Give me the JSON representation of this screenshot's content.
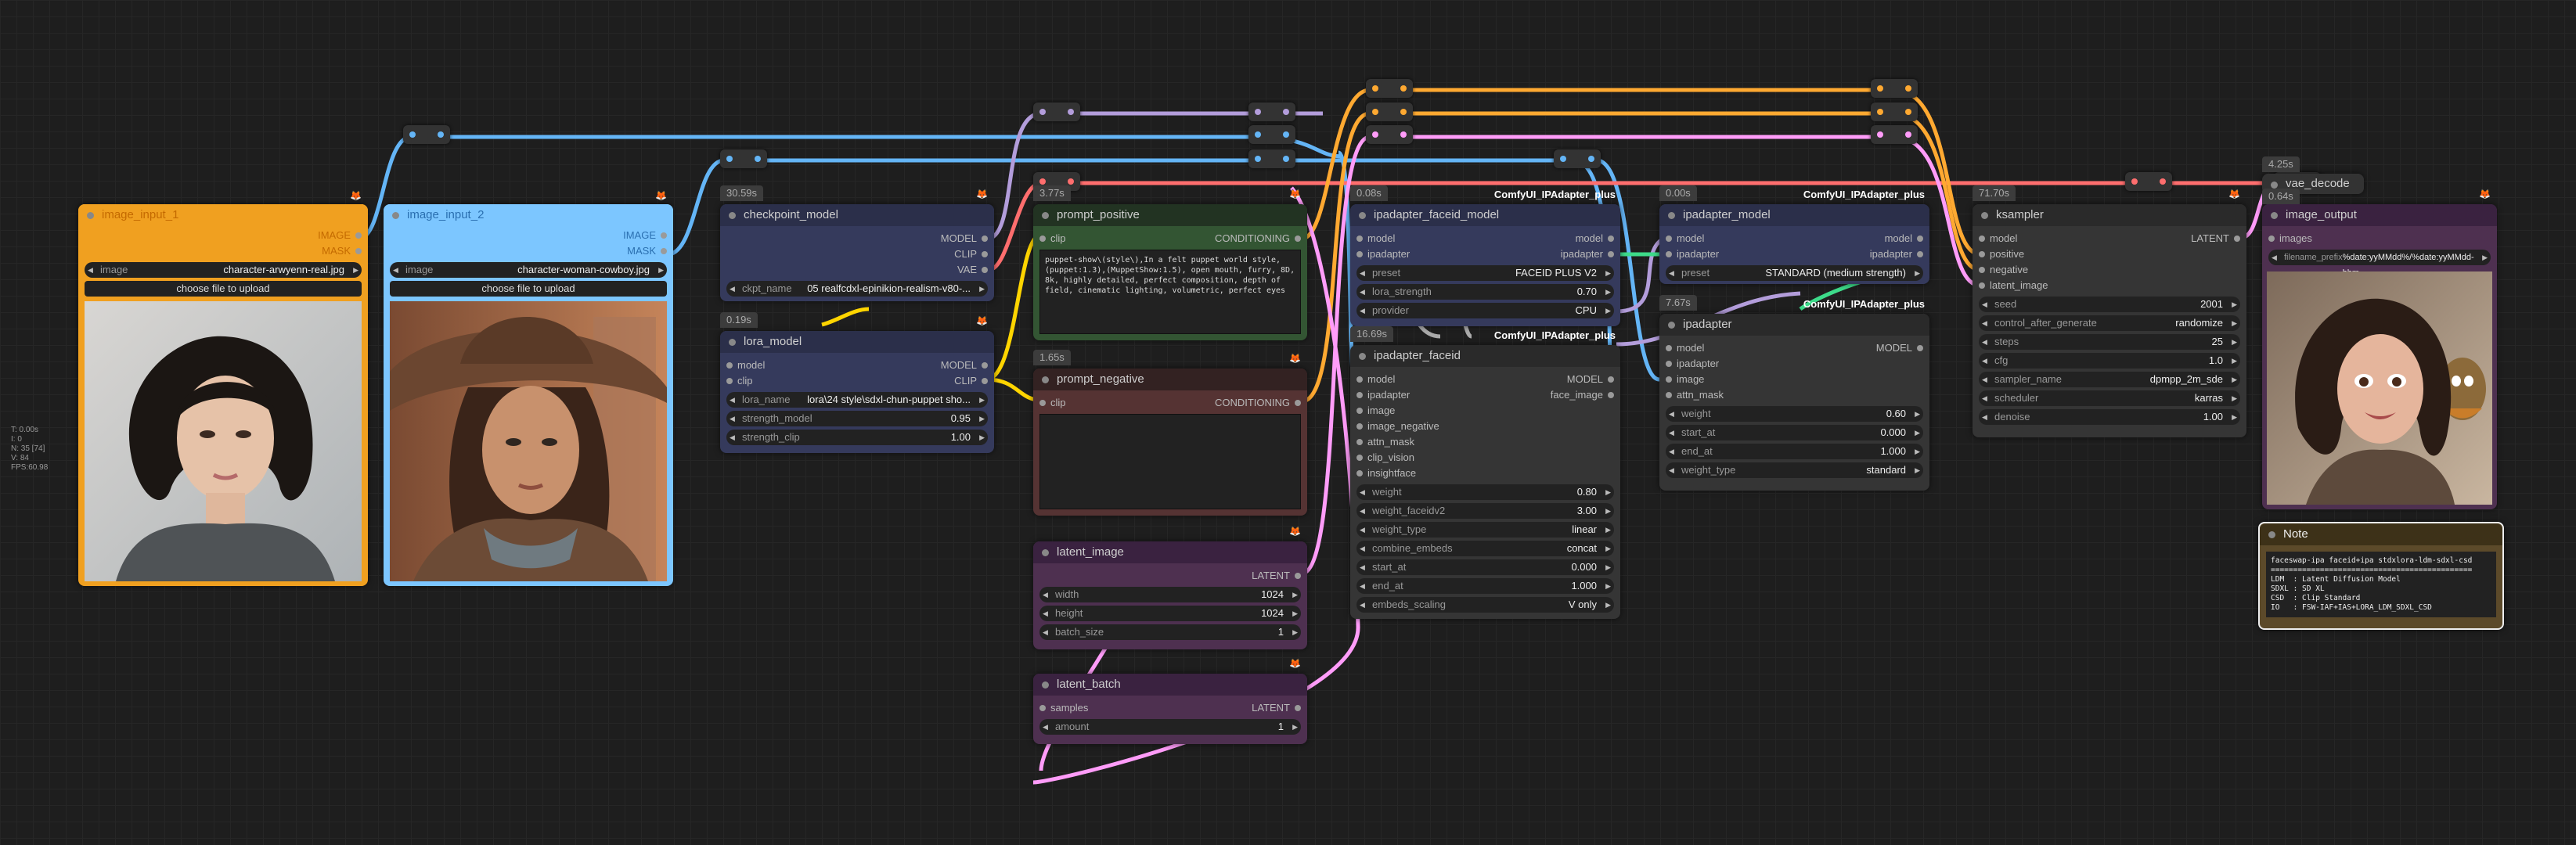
{
  "stats": [
    "T: 0.00s",
    "I: 0",
    "N: 35 [74]",
    "V: 84",
    "FPS:60.98"
  ],
  "nodes": {
    "image_input_1": {
      "title": "image_input_1",
      "outputs": [
        "IMAGE",
        "MASK"
      ],
      "widget_label": "image",
      "widget_value": "character-arwyenn-real.jpg",
      "button": "choose file to upload"
    },
    "image_input_2": {
      "title": "image_input_2",
      "outputs": [
        "IMAGE",
        "MASK"
      ],
      "widget_label": "image",
      "widget_value": "character-woman-cowboy.jpg",
      "button": "choose file to upload"
    },
    "checkpoint_model": {
      "time": "30.59s",
      "title": "checkpoint_model",
      "outputs": [
        "MODEL",
        "CLIP",
        "VAE"
      ],
      "widgets": [
        {
          "label": "ckpt_name",
          "value": "05 realfcdxl-epinikion-realism-v80-..."
        }
      ]
    },
    "lora_model": {
      "time": "0.19s",
      "title": "lora_model",
      "io": [
        {
          "in": "model",
          "out": "MODEL"
        },
        {
          "in": "clip",
          "out": "CLIP"
        }
      ],
      "widgets": [
        {
          "label": "lora_name",
          "value": "lora\\24 style\\sdxl-chun-puppet sho..."
        },
        {
          "label": "strength_model",
          "value": "0.95"
        },
        {
          "label": "strength_clip",
          "value": "1.00"
        }
      ]
    },
    "prompt_positive": {
      "time": "3.77s",
      "title": "prompt_positive",
      "input": "clip",
      "output": "CONDITIONING",
      "text": "puppet-show\\(style\\),In a felt puppet world style, (puppet:1.3),(MuppetShow:1.5), open mouth, furry, 8D, 8k, highly detailed, perfect composition, depth of field, cinematic lighting, volumetric, perfect eyes"
    },
    "prompt_negative": {
      "time": "1.65s",
      "title": "prompt_negative",
      "input": "clip",
      "output": "CONDITIONING",
      "text": ""
    },
    "latent_image": {
      "title": "latent_image",
      "output": "LATENT",
      "widgets": [
        {
          "label": "width",
          "value": "1024"
        },
        {
          "label": "height",
          "value": "1024"
        },
        {
          "label": "batch_size",
          "value": "1"
        }
      ]
    },
    "latent_batch": {
      "title": "latent_batch",
      "input": "samples",
      "output": "LATENT",
      "widgets": [
        {
          "label": "amount",
          "value": "1"
        }
      ]
    },
    "ipadapter_faceid_model": {
      "time": "0.08s",
      "pack": "ComfyUI_IPAdapter_plus",
      "title": "ipadapter_faceid_model",
      "io": [
        {
          "in": "model",
          "out": "model"
        },
        {
          "in": "ipadapter",
          "out": "ipadapter"
        }
      ],
      "widgets": [
        {
          "label": "preset",
          "value": "FACEID PLUS V2"
        },
        {
          "label": "lora_strength",
          "value": "0.70"
        },
        {
          "label": "provider",
          "value": "CPU"
        }
      ]
    },
    "ipadapter_faceid": {
      "time": "16.69s",
      "pack": "ComfyUI_IPAdapter_plus",
      "title": "ipadapter_faceid",
      "io": [
        {
          "in": "model",
          "out": "MODEL"
        },
        {
          "in": "ipadapter",
          "out": "face_image"
        }
      ],
      "inputs": [
        "image",
        "image_negative",
        "attn_mask",
        "clip_vision",
        "insightface"
      ],
      "widgets": [
        {
          "label": "weight",
          "value": "0.80"
        },
        {
          "label": "weight_faceidv2",
          "value": "3.00"
        },
        {
          "label": "weight_type",
          "value": "linear"
        },
        {
          "label": "combine_embeds",
          "value": "concat"
        },
        {
          "label": "start_at",
          "value": "0.000"
        },
        {
          "label": "end_at",
          "value": "1.000"
        },
        {
          "label": "embeds_scaling",
          "value": "V only"
        }
      ]
    },
    "ipadapter_model": {
      "time": "0.00s",
      "pack": "ComfyUI_IPAdapter_plus",
      "title": "ipadapter_model",
      "io": [
        {
          "in": "model",
          "out": "model"
        },
        {
          "in": "ipadapter",
          "out": "ipadapter"
        }
      ],
      "widgets": [
        {
          "label": "preset",
          "value": "STANDARD (medium strength)"
        }
      ]
    },
    "ipadapter": {
      "time": "7.67s",
      "pack": "ComfyUI_IPAdapter_plus",
      "title": "ipadapter",
      "io_out": "MODEL",
      "inputs": [
        "model",
        "ipadapter",
        "image",
        "attn_mask"
      ],
      "widgets": [
        {
          "label": "weight",
          "value": "0.60"
        },
        {
          "label": "start_at",
          "value": "0.000"
        },
        {
          "label": "end_at",
          "value": "1.000"
        },
        {
          "label": "weight_type",
          "value": "standard"
        }
      ]
    },
    "ksampler": {
      "time": "71.70s",
      "title": "ksampler",
      "output": "LATENT",
      "inputs": [
        "model",
        "positive",
        "negative",
        "latent_image"
      ],
      "widgets": [
        {
          "label": "seed",
          "value": "2001"
        },
        {
          "label": "control_after_generate",
          "value": "randomize"
        },
        {
          "label": "steps",
          "value": "25"
        },
        {
          "label": "cfg",
          "value": "1.0"
        },
        {
          "label": "sampler_name",
          "value": "dpmpp_2m_sde"
        },
        {
          "label": "scheduler",
          "value": "karras"
        },
        {
          "label": "denoise",
          "value": "1.00"
        }
      ]
    },
    "vae_decode": {
      "time": "4.25s",
      "title": "vae_decode"
    },
    "image_output": {
      "time": "0.64s",
      "title": "image_output",
      "input": "images",
      "filename_label": "filename_prefix",
      "filename_value": "%date:yyMMdd%/%date:yyMMdd-hhm"
    },
    "note": {
      "title": "Note",
      "text": "faceswap-ipa faceid+ipa stdxlora-ldm-sdxl-csd\n=============================================\nLDM  : Latent Diffusion Model\nSDXL : SD XL\nCSD  : Clip Standard\nIO   : FSW-IAF+IAS+LORA_LDM_SDXL_CSD"
    }
  },
  "colors": {
    "orange": "#f0a020",
    "blue": "#7cc6ff",
    "model_wire": "#b39ddb",
    "clip_wire": "#ffd500",
    "vae_wire": "#ff6e6e",
    "cond_wire": "#ffa931",
    "latent_wire": "#ff9cf9",
    "image_wire": "#64b5f6",
    "ipadapter_wire": "#3ddb8a"
  }
}
